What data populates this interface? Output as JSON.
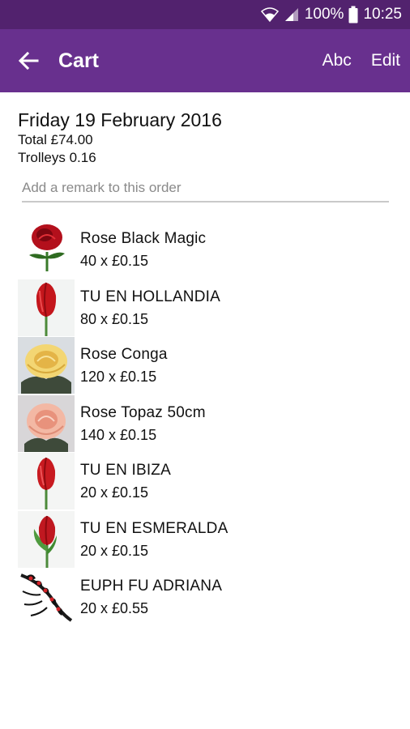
{
  "status_bar": {
    "battery": "100%",
    "time": "10:25"
  },
  "app_bar": {
    "title": "Cart",
    "abc_label": "Abc",
    "edit_label": "Edit"
  },
  "order": {
    "date": "Friday 19 February 2016",
    "total": "Total £74.00",
    "trolleys": "Trolleys 0.16",
    "remark_placeholder": "Add a remark to this order"
  },
  "items": [
    {
      "name": "Rose Black Magic",
      "qty": "40 x £0.15",
      "icon": "red-rose-icon"
    },
    {
      "name": "TU EN HOLLANDIA",
      "qty": "80 x £0.15",
      "icon": "red-tulip-icon"
    },
    {
      "name": "Rose Conga",
      "qty": "120 x £0.15",
      "icon": "yellow-rose-icon"
    },
    {
      "name": "Rose Topaz 50cm",
      "qty": "140 x £0.15",
      "icon": "peach-rose-icon"
    },
    {
      "name": "TU EN IBIZA",
      "qty": "20 x £0.15",
      "icon": "red-tulip-icon"
    },
    {
      "name": "TU EN ESMERALDA",
      "qty": "20 x £0.15",
      "icon": "red-tulip-leaves-icon"
    },
    {
      "name": "EUPH FU ADRIANA",
      "qty": "20 x £0.55",
      "icon": "euphorbia-icon"
    }
  ],
  "colors": {
    "status_bar": "#52226e",
    "app_bar": "#68308e"
  }
}
